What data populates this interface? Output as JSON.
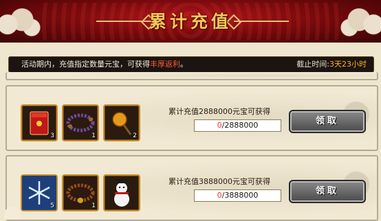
{
  "header": {
    "title": "累计充值"
  },
  "info_bar": {
    "text_before": "活动期内，充值指定数量元宝，可获得",
    "text_highlight": "丰厚返利",
    "text_after": "。",
    "deadline_label": "截止时间:",
    "deadline_value": "3天23小时"
  },
  "rewards": [
    {
      "goal_text": "累计充值2888000元宝可获得",
      "progress_current": "0",
      "progress_sep": "/",
      "progress_target": "2888000",
      "claim_label": "领取",
      "items": [
        {
          "icon": "red-envelope-icon",
          "count": "3"
        },
        {
          "icon": "bead-necklace-icon",
          "count": "1"
        },
        {
          "icon": "golden-staff-icon",
          "count": "2"
        }
      ]
    },
    {
      "goal_text": "累计充值3888000元宝可获得",
      "progress_current": "0",
      "progress_sep": "/",
      "progress_target": "3888000",
      "claim_label": "领取",
      "items": [
        {
          "icon": "snowflake-icon",
          "count": "5"
        },
        {
          "icon": "bead-necklace-icon",
          "count": "1"
        },
        {
          "icon": "snowman-icon",
          "count": ""
        }
      ]
    }
  ],
  "colors": {
    "banner_red": "#7a0a0d",
    "title_gold": "#f6c75a",
    "highlight_red": "#ff5a3c",
    "deadline_orange": "#ffb21a",
    "progress_red": "#e03a2a"
  }
}
